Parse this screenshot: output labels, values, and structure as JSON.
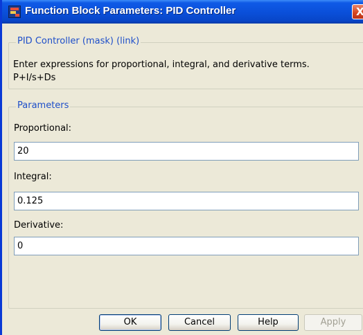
{
  "window": {
    "title": "Function Block Parameters: PID Controller",
    "close_glyph": "X"
  },
  "block": {
    "legend": "PID Controller (mask) (link)",
    "description": "Enter expressions for proportional, integral, and derivative terms.",
    "formula": "P+I/s+Ds"
  },
  "parameters": {
    "legend": "Parameters",
    "fields": [
      {
        "label": "Proportional:",
        "value": "20"
      },
      {
        "label": "Integral:",
        "value": "0.125"
      },
      {
        "label": "Derivative:",
        "value": "0"
      }
    ]
  },
  "buttons": {
    "ok": "OK",
    "cancel": "Cancel",
    "help": "Help",
    "apply": "Apply"
  },
  "colors": {
    "titlebar": "#0a4fd9",
    "legend_text": "#1d4ec9",
    "dialog_bg": "#ece9d8",
    "close_button": "#d6441d"
  },
  "icons": {
    "window_icon": "simulink-block-icon",
    "close": "close-icon"
  }
}
